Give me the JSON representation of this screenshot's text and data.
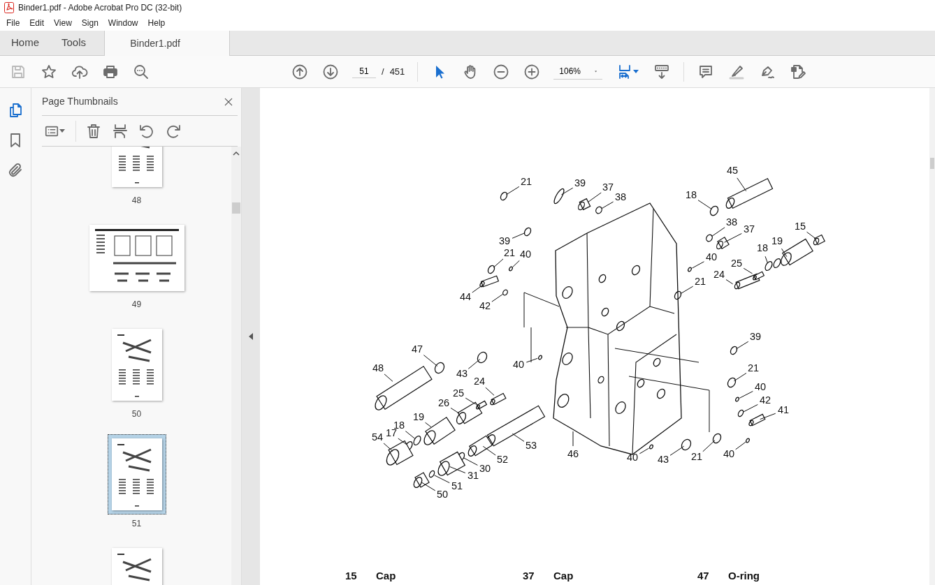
{
  "window": {
    "title": "Binder1.pdf - Adobe Acrobat Pro DC (32-bit)"
  },
  "menu": [
    "File",
    "Edit",
    "View",
    "Sign",
    "Window",
    "Help"
  ],
  "tabs": [
    {
      "label": "Home",
      "selected": false
    },
    {
      "label": "Tools",
      "selected": false
    },
    {
      "label": "Binder1.pdf",
      "selected": true
    }
  ],
  "toolbar": {
    "left_tools": [
      {
        "kind": "save",
        "disabled": true
      },
      {
        "kind": "star",
        "disabled": false
      },
      {
        "kind": "upload",
        "disabled": false
      },
      {
        "kind": "print",
        "disabled": false
      },
      {
        "kind": "find",
        "disabled": false
      }
    ],
    "page": "51",
    "page_separator": "/",
    "page_total": "451",
    "zoom": "106%"
  },
  "side_rail": [
    {
      "kind": "pages",
      "selected": true
    },
    {
      "kind": "bookmarks",
      "selected": false
    },
    {
      "kind": "attachments",
      "selected": false
    }
  ],
  "panel": {
    "title": "Page Thumbnails",
    "thumbnails": [
      {
        "label": "48",
        "kind": "portrait",
        "selected": false
      },
      {
        "label": "49",
        "kind": "landscape",
        "selected": false
      },
      {
        "label": "50",
        "kind": "portrait",
        "selected": false
      },
      {
        "label": "51",
        "kind": "portrait",
        "selected": true
      },
      {
        "kind": "portrait",
        "selected": false
      }
    ]
  },
  "page": {
    "callouts": [
      "21",
      "39",
      "37",
      "38",
      "45",
      "18",
      "15",
      "39",
      "38",
      "37",
      "21",
      "40",
      "19",
      "18",
      "40",
      "25",
      "24",
      "44",
      "42",
      "21",
      "39",
      "47",
      "48",
      "43",
      "40",
      "21",
      "24",
      "40",
      "25",
      "42",
      "26",
      "41",
      "18",
      "19",
      "17",
      "54",
      "53",
      "46",
      "40",
      "43",
      "21",
      "40",
      "52",
      "30",
      "31",
      "51",
      "50"
    ],
    "legend": [
      {
        "number": "15",
        "name": "Cap"
      },
      {
        "number": "37",
        "name": "Cap"
      },
      {
        "number": "47",
        "name": "O-ring"
      }
    ]
  }
}
